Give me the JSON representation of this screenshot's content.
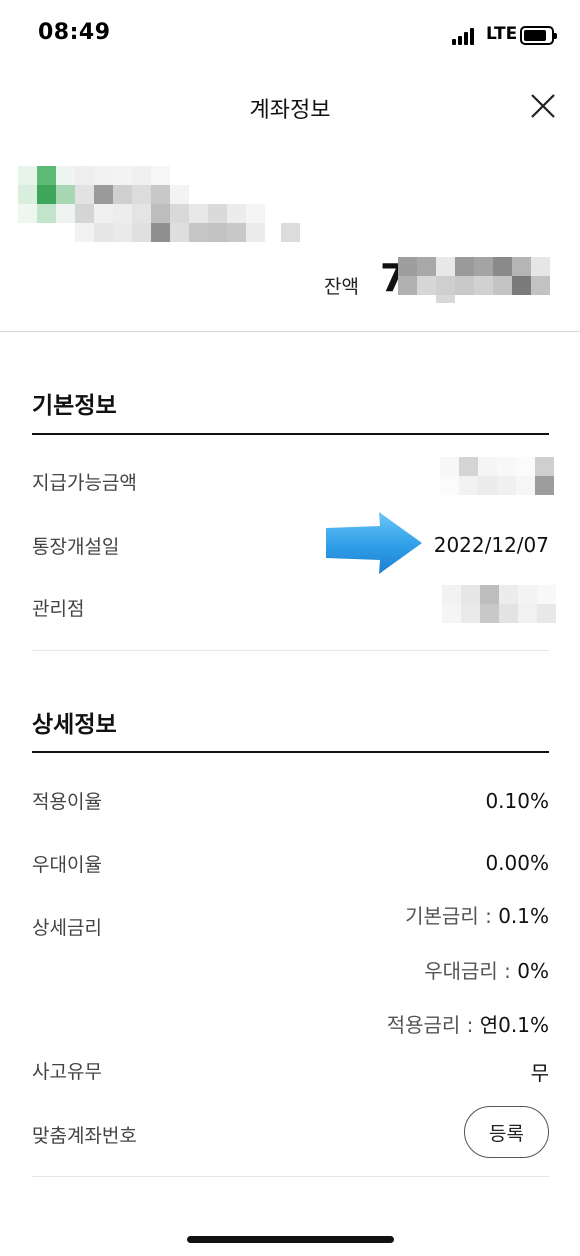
{
  "status_bar": {
    "time": "08:49",
    "network": "LTE"
  },
  "header": {
    "title": "계좌정보"
  },
  "account": {
    "balance_label": "잔액",
    "balance_prefix": "7"
  },
  "basic_info": {
    "title": "기본정보",
    "rows": [
      {
        "label": "지급가능금액"
      },
      {
        "label": "통장개설일",
        "value": "2022/12/07"
      },
      {
        "label": "관리점"
      }
    ]
  },
  "detail_info": {
    "title": "상세정보",
    "applied_rate": {
      "label": "적용이율",
      "value": "0.10%"
    },
    "preferential_rate": {
      "label": "우대이율",
      "value": "0.00%"
    },
    "detail_rate": {
      "label": "상세금리",
      "lines": [
        {
          "prefix": "기본금리 : ",
          "value": "0.1%"
        },
        {
          "prefix": "우대금리 : ",
          "value": "0%"
        },
        {
          "prefix": "적용금리 : ",
          "value": "연0.1%"
        }
      ]
    },
    "accident": {
      "label": "사고유무",
      "value": "무"
    },
    "custom_account": {
      "label": "맞춤계좌번호",
      "button_label": "등록"
    }
  },
  "colors": {
    "arrow": "#3aa8ea",
    "text": "#111111",
    "divider": "#d9d9d9"
  }
}
